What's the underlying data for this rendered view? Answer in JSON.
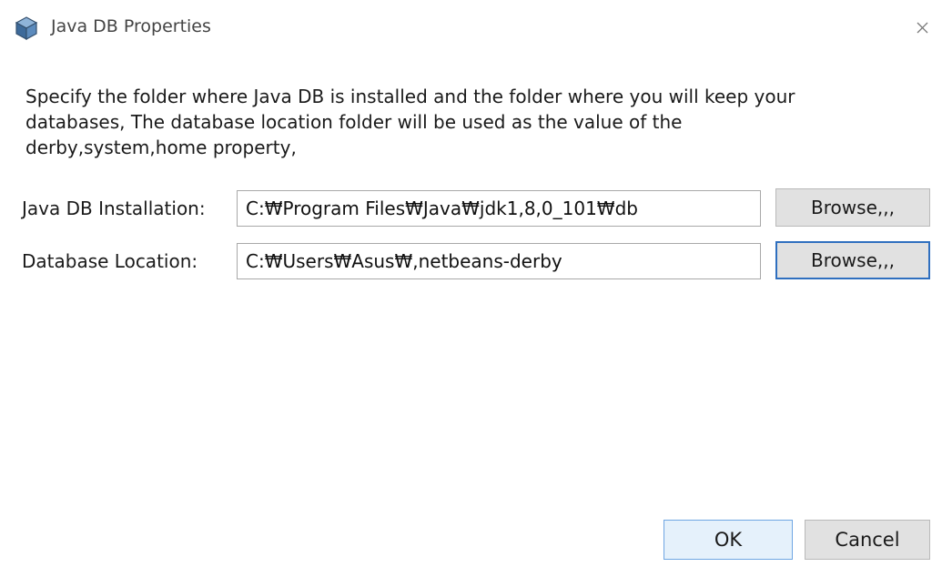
{
  "window": {
    "title": "Java DB Properties",
    "icon": "java-db-cube-icon",
    "close_icon": "close-icon"
  },
  "description": {
    "lines": [
      "Specify the folder where Java DB is installed and the folder where you will keep your",
      "databases, The database location folder will be used as the value of the",
      "derby,system,home property,"
    ]
  },
  "fields": {
    "installation": {
      "label": "Java DB Installation:",
      "value": "C:₩Program Files₩Java₩jdk1,8,0_101₩db",
      "browse_label": "Browse,,,"
    },
    "location": {
      "label": "Database Location:",
      "value": "C:₩Users₩Asus₩,netbeans-derby",
      "browse_label": "Browse,,,"
    }
  },
  "buttons": {
    "ok": "OK",
    "cancel": "Cancel"
  },
  "colors": {
    "focus_border": "#2f6fbf",
    "default_button_border": "#6fa6e3",
    "default_button_bg": "#e5f1fb",
    "button_bg": "#e1e1e1"
  }
}
